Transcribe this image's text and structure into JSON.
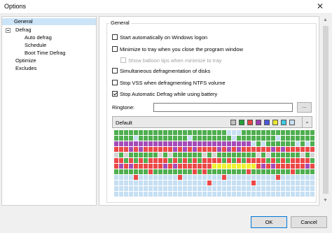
{
  "window": {
    "title": "Options",
    "close_glyph": "✕"
  },
  "tree": {
    "items": [
      {
        "label": "General",
        "level": 0,
        "selected": true
      },
      {
        "label": "Defrag",
        "level": 0,
        "expanded": true
      },
      {
        "label": "Auto defrag",
        "level": 1
      },
      {
        "label": "Schedule",
        "level": 1
      },
      {
        "label": "Boot Time Defrag",
        "level": 1
      },
      {
        "label": "Optimize",
        "level": 0
      },
      {
        "label": "Excludes",
        "level": 0
      }
    ]
  },
  "general": {
    "group_title": "General",
    "options": [
      {
        "label": "Start automatically on Windows logon",
        "checked": false,
        "enabled": true
      },
      {
        "label": "Minimize to tray when you close the program window",
        "checked": false,
        "enabled": true
      },
      {
        "label": "Show balloon tips when minimize to tray",
        "checked": false,
        "enabled": false
      },
      {
        "label": "Simultaneous defragmentation of disks",
        "checked": false,
        "enabled": true
      },
      {
        "label": "Stop VSS when defragmenting NTFS volume",
        "checked": false,
        "enabled": true
      },
      {
        "label": "Stop Automatic Defrag while using battery",
        "checked": true,
        "enabled": true
      }
    ],
    "ringtone_label": "Ringtone:",
    "ringtone_value": "",
    "browse_label": "...",
    "scheme_value": "Default",
    "scheme_colors": [
      "#c0c0c0",
      "#22a33a",
      "#e34848",
      "#9a3fb0",
      "#4a5ad8",
      "#e8e830",
      "#40c8e0",
      "#c8e0f4"
    ]
  },
  "buttons": {
    "ok": "OK",
    "cancel": "Cancel"
  },
  "map_colors": {
    "green": "#4fae4f",
    "red": "#ec4848",
    "purple": "#a34cb8",
    "yellow": "#f0f030",
    "light": "#c6dff3",
    "gray": "#d4d4d4",
    "cyan": "#56c9e2",
    "blue": "#4a5ad8"
  }
}
